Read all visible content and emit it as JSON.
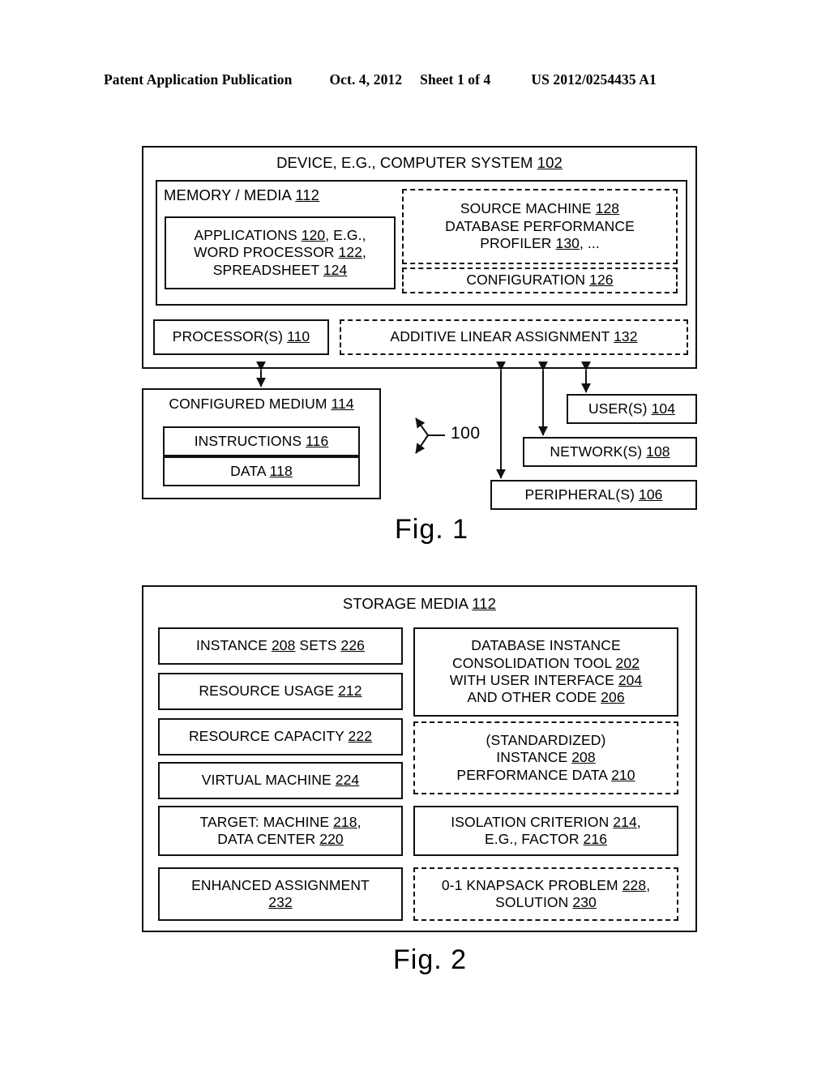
{
  "header": {
    "publication": "Patent Application Publication",
    "date": "Oct. 4, 2012",
    "sheet": "Sheet 1 of 4",
    "patent_number": "US 2012/0254435 A1"
  },
  "figure1": {
    "caption": "Fig. 1",
    "system_ref": "100",
    "device_title": "DEVICE, E.G., COMPUTER SYSTEM 102",
    "device_title_plain": "DEVICE, E.G., COMPUTER SYSTEM ",
    "device_title_ref": "102",
    "memory": {
      "label_plain": "MEMORY / MEDIA ",
      "label_ref": "112"
    },
    "applications": {
      "line1_plain": "APPLICATIONS ",
      "line1_ref": "120",
      "line1_tail": ", E.G.,",
      "line2_plain": "WORD PROCESSOR ",
      "line2_ref": "122",
      "line2_tail": ",",
      "line3_plain": "SPREADSHEET ",
      "line3_ref": "124"
    },
    "source_machine": {
      "line1_plain": "SOURCE MACHINE ",
      "line1_ref": "128",
      "line2_plain": "DATABASE PERFORMANCE",
      "line3_plain": "PROFILER ",
      "line3_ref": "130",
      "line3_tail": ", ..."
    },
    "configuration": {
      "label_plain": "CONFIGURATION ",
      "label_ref": "126"
    },
    "processors": {
      "label_plain": "PROCESSOR(S) ",
      "label_ref": "110"
    },
    "additive": {
      "label_plain": "ADDITIVE LINEAR ASSIGNMENT  ",
      "label_ref": "132"
    },
    "configured_medium": {
      "label_plain": "CONFIGURED MEDIUM ",
      "label_ref": "114"
    },
    "instructions": {
      "label_plain": "INSTRUCTIONS ",
      "label_ref": "116"
    },
    "data": {
      "label_plain": "DATA ",
      "label_ref": "118"
    },
    "users": {
      "label_plain": "USER(S) ",
      "label_ref": "104"
    },
    "networks": {
      "label_plain": "NETWORK(S) ",
      "label_ref": "108"
    },
    "peripherals": {
      "label_plain": "PERIPHERAL(S) ",
      "label_ref": "106"
    }
  },
  "figure2": {
    "caption": "Fig. 2",
    "storage_title_plain": "STORAGE MEDIA ",
    "storage_title_ref": "112",
    "left_column": [
      {
        "name": "instance-sets",
        "lines": [
          {
            "plain": "INSTANCE ",
            "ref": "208",
            "tail": " SETS ",
            "ref2": "226"
          }
        ]
      },
      {
        "name": "resource-usage",
        "lines": [
          {
            "plain": "RESOURCE USAGE ",
            "ref": "212"
          }
        ]
      },
      {
        "name": "resource-capacity",
        "lines": [
          {
            "plain": "RESOURCE CAPACITY ",
            "ref": "222"
          }
        ]
      },
      {
        "name": "virtual-machine",
        "lines": [
          {
            "plain": "VIRTUAL MACHINE ",
            "ref": "224"
          }
        ]
      },
      {
        "name": "target-machine-data-center",
        "lines": [
          {
            "plain": "TARGET: MACHINE ",
            "ref": "218",
            "tail": ","
          },
          {
            "plain": "DATA CENTER ",
            "ref": "220"
          }
        ]
      },
      {
        "name": "enhanced-assignment",
        "lines": [
          {
            "plain": "ENHANCED ASSIGNMENT"
          },
          {
            "plain": "",
            "ref": "232"
          }
        ]
      }
    ],
    "right_column": [
      {
        "name": "db-instance-consolidation-tool",
        "dashed": false,
        "lines": [
          {
            "plain": "DATABASE INSTANCE"
          },
          {
            "plain": "CONSOLIDATION TOOL ",
            "ref": "202"
          },
          {
            "plain": "WITH USER INTERFACE ",
            "ref": "204"
          },
          {
            "plain": "AND OTHER CODE ",
            "ref": "206"
          }
        ]
      },
      {
        "name": "standardized-instance-performance-data",
        "dashed": true,
        "lines": [
          {
            "plain": "(STANDARDIZED)"
          },
          {
            "plain": "INSTANCE ",
            "ref": "208"
          },
          {
            "plain": "PERFORMANCE DATA ",
            "ref": "210"
          }
        ]
      },
      {
        "name": "isolation-criterion",
        "dashed": false,
        "lines": [
          {
            "plain": "ISOLATION CRITERION ",
            "ref": "214",
            "tail": ","
          },
          {
            "plain": "E.G., FACTOR ",
            "ref": "216"
          }
        ]
      },
      {
        "name": "knapsack-problem-solution",
        "dashed": true,
        "lines": [
          {
            "plain": "0-1 KNAPSACK PROBLEM ",
            "ref": "228",
            "tail": ","
          },
          {
            "plain": "SOLUTION ",
            "ref": "230"
          }
        ]
      }
    ]
  }
}
